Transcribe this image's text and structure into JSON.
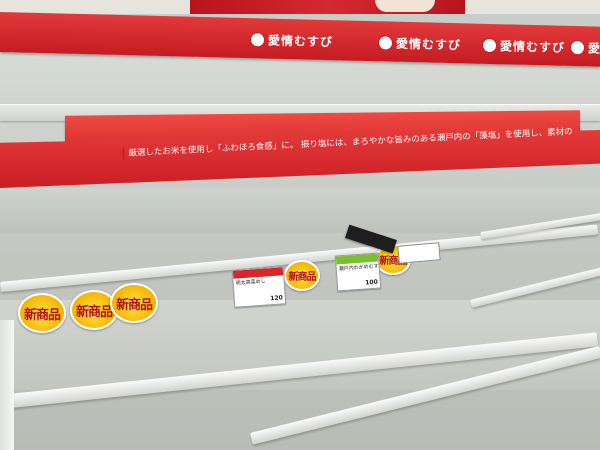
{
  "shelf_top": {
    "brand_label": "愛情むすび",
    "repeats": 4
  },
  "shelf_middle": {
    "slogan": "厳選したお米を使用し「ふわほろ食感」に。 振り塩には、まろやかな旨みのある瀬戸内の「藻塩」を使用し、素材の味を生かしました。"
  },
  "stickers": [
    {
      "text": "新商品"
    },
    {
      "text": "新商品"
    },
    {
      "text": "新商品"
    },
    {
      "text": "新商品"
    },
    {
      "text": "新商品"
    }
  ],
  "price_tags": [
    {
      "name": "明太高菜めし",
      "price": "120"
    },
    {
      "name": "瀬戸内わかめむすび",
      "price": "100"
    }
  ],
  "colors": {
    "shelf_red": "#c41c22",
    "sticker_yellow": "#f6b400",
    "sticker_text": "#b3121c",
    "tray_white": "#f4f5f2"
  }
}
